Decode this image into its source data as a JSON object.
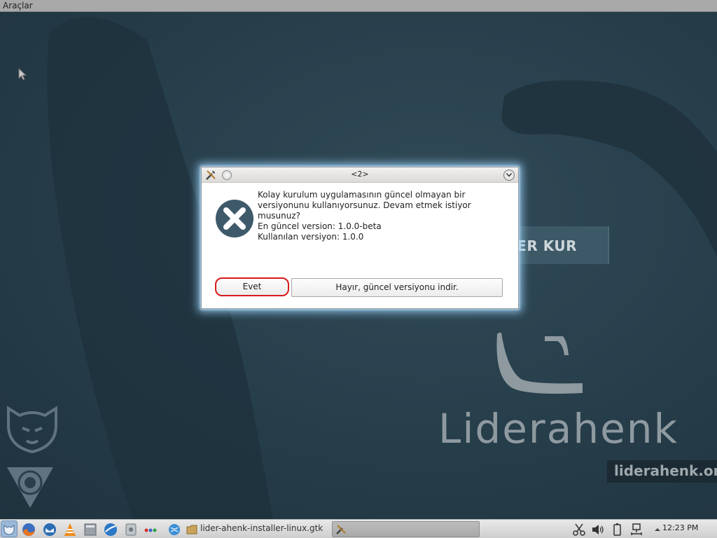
{
  "menubar": {
    "tools_label": "Araçlar"
  },
  "desktop": {
    "install_button_label": "DER KUR",
    "logo_text": "Liderahenk",
    "logo_url": "liderahenk.org."
  },
  "dialog": {
    "title": "<2>",
    "icon": "error-x-icon",
    "message_lines": [
      "Kolay kurulum uygulamasının güncel olmayan bir",
      "versiyonunu kullanıyorsunuz. Devam etmek istiyor",
      "musunuz?",
      "En güncel version: 1.0.0-beta",
      "Kullanılan versiyon: 1.0.0"
    ],
    "yes_label": "Evet",
    "no_label": "Hayır, güncel versiyonu indir."
  },
  "taskbar": {
    "launchers": [
      "start-menu-icon",
      "firefox-icon",
      "thunderbird-icon",
      "vlc-icon",
      "files-icon",
      "browser-icon",
      "settings-icon",
      "dots-icon",
      "network-globe-icon"
    ],
    "tasks": [
      {
        "label": "lider-ahenk-installer-linux.gtk",
        "icon": "folder-icon"
      },
      {
        "label": "",
        "icon": "tools-icon"
      }
    ],
    "tray": [
      "scissors-icon",
      "volume-icon",
      "battery-icon",
      "network-icon",
      "tray-arrow-icon"
    ],
    "clock": "12:23 PM"
  },
  "colors": {
    "desktop_bg": "#253a47",
    "dialog_glow": "#a0d7ff",
    "yes_outline": "#d81b1b",
    "error_icon": "#3e5a6a"
  }
}
